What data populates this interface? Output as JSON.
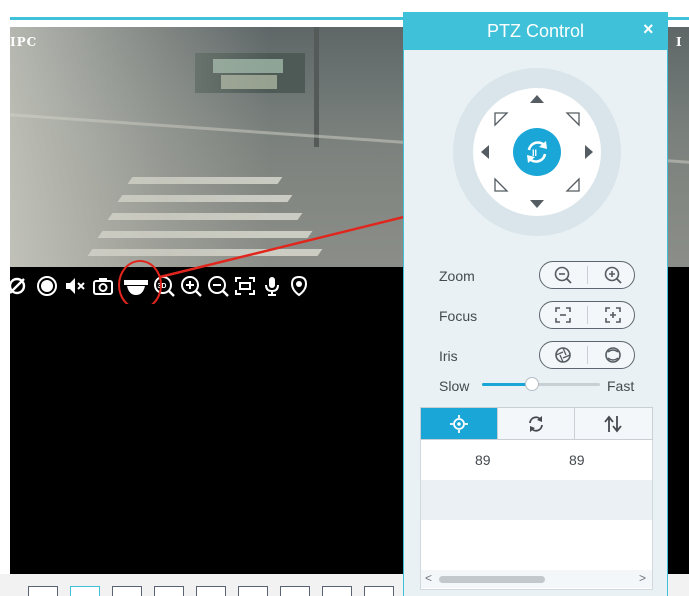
{
  "camera": {
    "label": "IPC",
    "label_right": "I"
  },
  "toolbar": {
    "icons": [
      "stop-icon",
      "record-icon",
      "mute-icon",
      "snapshot-icon",
      "ptz-icon",
      "3d-zoom-icon",
      "zoom-in-icon",
      "zoom-out-icon",
      "fullscreen-icon",
      "talk-icon",
      "fisheye-icon"
    ],
    "highlighted": "ptz-icon"
  },
  "ptz": {
    "title": "PTZ Control",
    "close": "×",
    "zoom_label": "Zoom",
    "focus_label": "Focus",
    "iris_label": "Iris",
    "speed": {
      "slow_label": "Slow",
      "fast_label": "Fast",
      "level": 0.42
    },
    "tabs": [
      "preset-icon",
      "cruise-icon",
      "track-icon"
    ],
    "active_tab": 0,
    "list": {
      "rows": [
        {
          "a": "89",
          "b": "89"
        }
      ]
    },
    "scroll_left": "<",
    "scroll_right": ">"
  },
  "colors": {
    "accent": "#3fc1d9",
    "button": "#1aa7d7",
    "highlight_ring": "#e0261d",
    "panel_bg": "#e9f1f4"
  }
}
